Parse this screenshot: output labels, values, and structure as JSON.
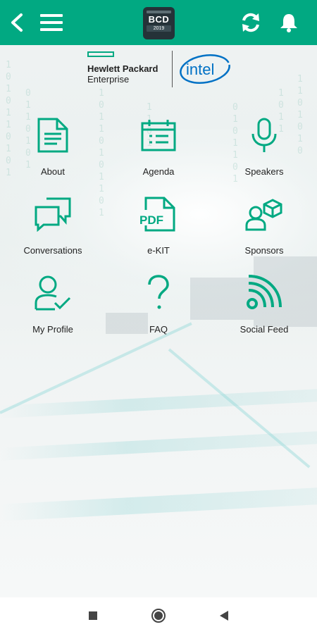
{
  "appbar": {
    "logo_title": "BCD",
    "logo_year": "2019",
    "accent": "#01a982",
    "icons": [
      "back-icon",
      "menu-icon",
      "sync-icon",
      "bell-icon"
    ]
  },
  "partners": {
    "hpe_line1": "Hewlett Packard",
    "hpe_line2": "Enterprise",
    "intel": "intel"
  },
  "menu": [
    {
      "label": "About",
      "icon": "document-icon"
    },
    {
      "label": "Agenda",
      "icon": "calendar-icon"
    },
    {
      "label": "Speakers",
      "icon": "microphone-icon"
    },
    {
      "label": "Conversations",
      "icon": "chat-bubbles-icon"
    },
    {
      "label": "e-KIT",
      "icon": "pdf-icon"
    },
    {
      "label": "Sponsors",
      "icon": "sponsor-icon"
    },
    {
      "label": "My Profile",
      "icon": "profile-check-icon"
    },
    {
      "label": "FAQ",
      "icon": "question-icon"
    },
    {
      "label": "Social Feed",
      "icon": "rss-icon"
    }
  ],
  "navbar": {
    "icons": [
      "recents-icon",
      "home-icon",
      "back-nav-icon"
    ]
  }
}
